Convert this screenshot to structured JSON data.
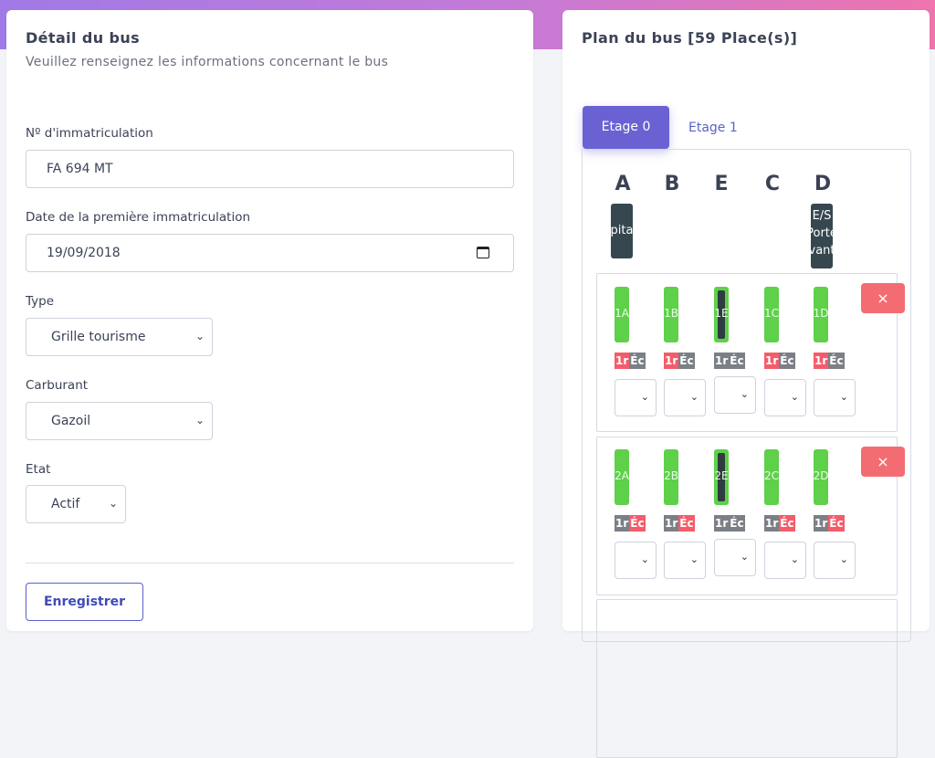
{
  "detail": {
    "title": "Détail du bus",
    "subtitle": "Veuillez renseignez les informations concernant le bus",
    "immat_label": "Nº d'immatriculation",
    "immat_value": "FA 694 MT",
    "date_label": "Date de la première immatriculation",
    "date_value": "19/09/2018",
    "type_label": "Type",
    "type_value": "Grille tourisme",
    "carburant_label": "Carburant",
    "carburant_value": "Gazoil",
    "etat_label": "Etat",
    "etat_value": "Actif",
    "save_label": "Enregistrer"
  },
  "plan": {
    "title": "Plan du bus [59 Place(s)]",
    "tabs": [
      "Etage 0",
      "Etage 1"
    ],
    "columns": [
      "A",
      "B",
      "E",
      "C",
      "D"
    ],
    "header_boxes": {
      "a": "pita",
      "d": [
        "E/S",
        "Porte",
        "vant"
      ]
    },
    "delete_icon": "×",
    "rows": [
      {
        "seats": [
          "1A",
          "1B",
          "1E",
          "1C",
          "1D"
        ],
        "badges": [
          {
            "first": "1r",
            "second": "Éc",
            "first_color": "red",
            "second_color": "gray"
          },
          {
            "first": "1r",
            "second": "Éc",
            "first_color": "red",
            "second_color": "gray"
          },
          {
            "first": "1r",
            "second": "Éc",
            "first_color": "gray",
            "second_color": "gray"
          },
          {
            "first": "1r",
            "second": "Éc",
            "first_color": "red",
            "second_color": "gray"
          },
          {
            "first": "1r",
            "second": "Éc",
            "first_color": "red",
            "second_color": "gray"
          }
        ]
      },
      {
        "seats": [
          "2A",
          "2B",
          "2E",
          "2C",
          "2D"
        ],
        "badges": [
          {
            "first": "1r",
            "second": "Éc",
            "first_color": "gray",
            "second_color": "red"
          },
          {
            "first": "1r",
            "second": "Éc",
            "first_color": "gray",
            "second_color": "red"
          },
          {
            "first": "1r",
            "second": "Éc",
            "first_color": "gray",
            "second_color": "gray"
          },
          {
            "first": "1r",
            "second": "Éc",
            "first_color": "gray",
            "second_color": "red"
          },
          {
            "first": "1r",
            "second": "Éc",
            "first_color": "gray",
            "second_color": "red"
          }
        ]
      }
    ]
  },
  "colors": {
    "accent": "#6a62d3",
    "seat_green": "#5ed04a",
    "danger": "#f36c72",
    "dark": "#37474f"
  }
}
